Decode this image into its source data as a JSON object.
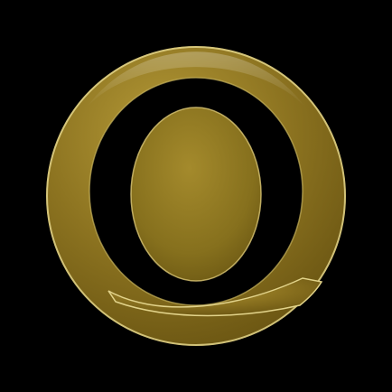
{
  "app_icon": {
    "logo_letter": "Q",
    "icon": "gold-q-logo-icon",
    "colors": {
      "background": "#000000",
      "gold_light": "#c9b052",
      "gold_mid": "#8c7320",
      "gold_dark": "#5a4810",
      "outline": "#e2d38a"
    }
  }
}
